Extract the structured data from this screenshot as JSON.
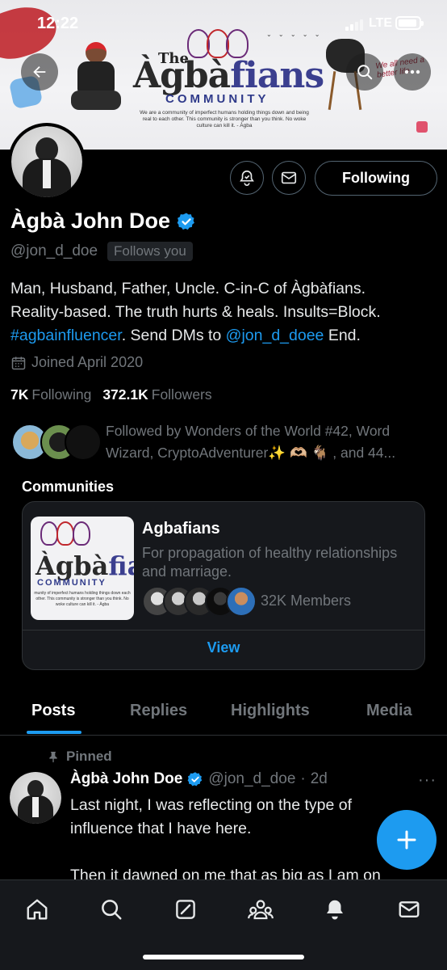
{
  "status_bar": {
    "time": "12:22",
    "network": "LTE"
  },
  "banner": {
    "title_the": "The",
    "title_main_prefix": "Àgbà",
    "title_main_suffix": "fians",
    "community": "COMMUNITY",
    "tagline": "We are a community of imperfect humans holding things down and being real to each other. This community is stronger than you think. No woke culture can kill it. - Àgba",
    "cursive": "We all need a better life"
  },
  "profile": {
    "name": "Àgbà John Doe",
    "handle": "@jon_d_doe",
    "follows_you": "Follows you",
    "following_button": "Following",
    "bio_line1": "Man, Husband, Father, Uncle. C-in-C of Àgbàfians.",
    "bio_line2": "Reality-based. The truth hurts & heals. Insults=Block.",
    "bio_hashtag": "#agbainfluencer",
    "bio_mid": ". Send DMs to ",
    "bio_mention": "@jon_d_doee",
    "bio_end": " End.",
    "joined": "Joined April 2020",
    "following_count": "7K",
    "following_label": "Following",
    "followers_count": "372.1K",
    "followers_label": "Followers",
    "followed_by_line1": "Followed by Wonders of the World #42, Word",
    "followed_by_line2": "Wizard, CryptoAdventurer✨ 🫶🏼 🐐 , and 44..."
  },
  "communities": {
    "title": "Communities",
    "card": {
      "thumb_title_prefix": "Àgbà",
      "thumb_title_suffix": "fians",
      "thumb_community": "COMMUNITY",
      "thumb_tagline": "munity of imperfect humans holding things down each other. This community is stronger than you think. No woke culture can kill it. - Àgba",
      "name": "Agbafians",
      "description": "For propagation of healthy relationships and marriage.",
      "members": "32K Members",
      "view": "View"
    }
  },
  "tabs": [
    "Posts",
    "Replies",
    "Highlights",
    "Media"
  ],
  "post": {
    "pinned": "Pinned",
    "name": "Àgbà John Doe",
    "handle": "@jon_d_doe",
    "separator": "·",
    "time": "2d",
    "more": "···",
    "line1": "Last night, I was reflecting on the type of",
    "line2": "influence that I have here.",
    "line3": "Then it dawned on me that as big as I am on"
  },
  "colors": {
    "accent": "#1d9bf0",
    "background": "#000000",
    "muted": "#71767b",
    "card": "#16181c"
  },
  "icons": [
    "back-arrow-icon",
    "search-icon",
    "more-icon",
    "bell-check-icon",
    "mail-icon",
    "verified-badge-icon",
    "calendar-icon",
    "pin-icon",
    "plus-icon",
    "home-icon",
    "search-nav-icon",
    "grok-icon",
    "communities-icon",
    "notifications-icon",
    "messages-icon"
  ]
}
